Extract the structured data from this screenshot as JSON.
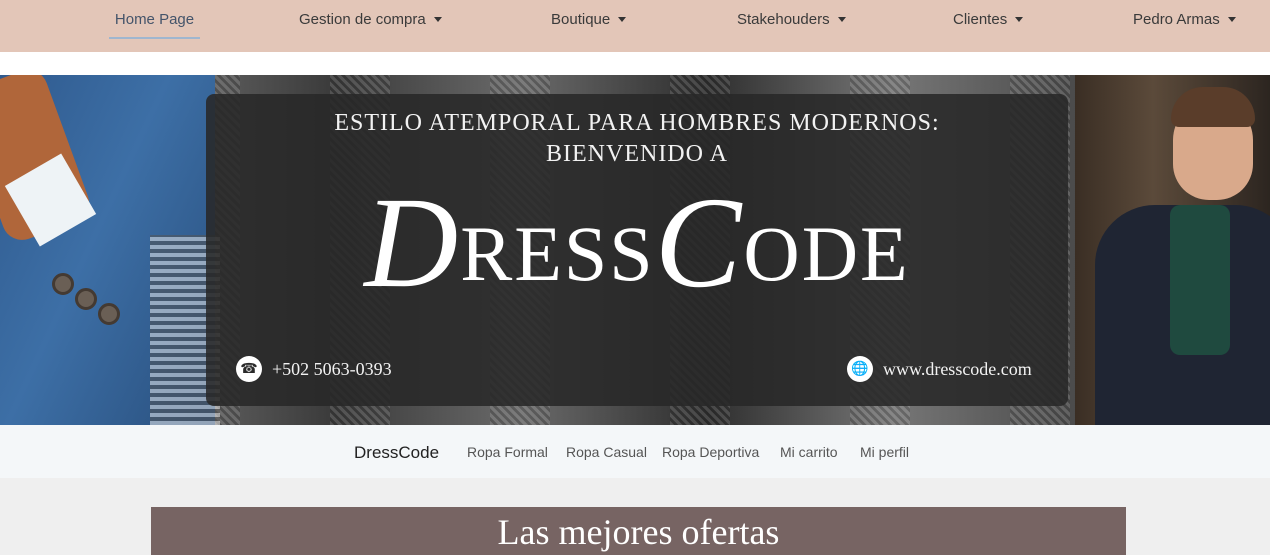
{
  "topnav": {
    "home": "Home Page",
    "items": [
      {
        "label": "Gestion de compra"
      },
      {
        "label": "Boutique"
      },
      {
        "label": "Stakehouders"
      },
      {
        "label": "Clientes"
      },
      {
        "label": "Pedro Armas"
      }
    ],
    "background": "#e3c6b8"
  },
  "banner": {
    "tagline_line1": "ESTILO ATEMPORAL PARA HOMBRES MODERNOS:",
    "tagline_line2": "BIENVENIDO A",
    "brand_d": "D",
    "brand_ress": "RESS",
    "brand_c": "C",
    "brand_ode": "ODE",
    "phone": "+502 5063-0393",
    "website": "www.dresscode.com",
    "phone_icon": "phone-icon",
    "globe_icon": "globe-icon"
  },
  "subnav": {
    "brand": "DressCode",
    "links": [
      "Ropa Formal",
      "Ropa Casual",
      "Ropa Deportiva",
      "Mi carrito",
      "Mi perfil"
    ]
  },
  "offers": {
    "title": "Las mejores ofertas",
    "background": "#776463"
  }
}
